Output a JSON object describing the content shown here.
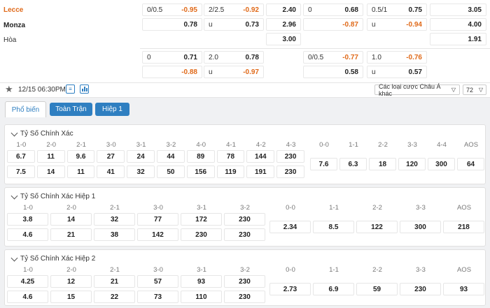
{
  "teams": {
    "home": "Lecce",
    "away": "Monza",
    "draw": "Hòa"
  },
  "top_odds": {
    "r1": [
      "0/0.5",
      "-0.95",
      "2/2.5",
      "-0.92",
      "2.40",
      "0",
      "0.68",
      "0.5/1",
      "0.75",
      "3.05"
    ],
    "r2": [
      "0.78",
      "u",
      "0.73",
      "2.96",
      "-0.87",
      "u",
      "-0.94",
      "4.00"
    ],
    "r3": [
      "3.00",
      "1.91"
    ],
    "r4": [
      "0",
      "0.71",
      "2.0",
      "0.78",
      "0/0.5",
      "-0.77",
      "1.0",
      "-0.76"
    ],
    "r5": [
      "-0.88",
      "u",
      "-0.97",
      "0.58",
      "u",
      "0.57"
    ]
  },
  "meta": {
    "datetime": "12/15 06:30PM",
    "market_select": "Các loại cược Châu Á khác",
    "count": "72"
  },
  "tabs": [
    "Phổ biến",
    "Toàn Trận",
    "Hiệp 1"
  ],
  "sections": [
    {
      "title": "Tỷ Số Chính Xác",
      "h1": [
        "1-0",
        "2-0",
        "2-1",
        "3-0",
        "3-1",
        "3-2",
        "4-0",
        "4-1",
        "4-2",
        "4-3"
      ],
      "row1": [
        "6.7",
        "11",
        "9.6",
        "27",
        "24",
        "44",
        "89",
        "78",
        "144",
        "230"
      ],
      "row2": [
        "7.5",
        "14",
        "11",
        "41",
        "32",
        "50",
        "156",
        "119",
        "191",
        "230"
      ],
      "h2": [
        "0-0",
        "1-1",
        "2-2",
        "3-3",
        "4-4",
        "AOS"
      ],
      "row3": [
        "7.6",
        "6.3",
        "18",
        "120",
        "300",
        "64"
      ]
    },
    {
      "title": "Tỷ Số Chính Xác Hiệp 1",
      "h1": [
        "1-0",
        "2-0",
        "2-1",
        "3-0",
        "3-1",
        "3-2"
      ],
      "row1": [
        "3.8",
        "14",
        "32",
        "77",
        "172",
        "230"
      ],
      "row2": [
        "4.6",
        "21",
        "38",
        "142",
        "230",
        "230"
      ],
      "h2": [
        "0-0",
        "1-1",
        "2-2",
        "3-3",
        "AOS"
      ],
      "row3": [
        "2.34",
        "8.5",
        "122",
        "300",
        "218"
      ]
    },
    {
      "title": "Tỷ Số Chính Xác Hiệp 2",
      "h1": [
        "1-0",
        "2-0",
        "2-1",
        "3-0",
        "3-1",
        "3-2"
      ],
      "row1": [
        "4.25",
        "12",
        "21",
        "57",
        "93",
        "230"
      ],
      "row2": [
        "4.6",
        "15",
        "22",
        "73",
        "110",
        "230"
      ],
      "h2": [
        "0-0",
        "1-1",
        "2-2",
        "3-3",
        "AOS"
      ],
      "row3": [
        "2.73",
        "6.9",
        "59",
        "230",
        "93"
      ]
    }
  ],
  "colors": {
    "accent": "#2f7fc1",
    "negative": "#e06a1a"
  }
}
